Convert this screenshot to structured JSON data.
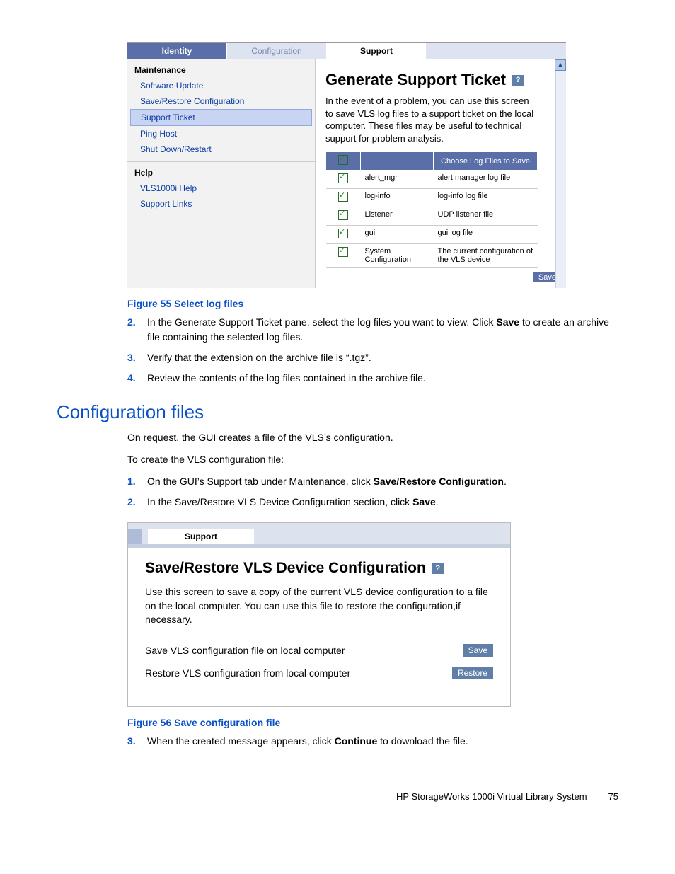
{
  "fig55": {
    "tabs": {
      "identity": "Identity",
      "configuration": "Configuration",
      "support": "Support"
    },
    "sidebar": {
      "maintenance_header": "Maintenance",
      "items_maint": [
        "Software Update",
        "Save/Restore Configuration",
        "Support Ticket",
        "Ping Host",
        "Shut Down/Restart"
      ],
      "help_header": "Help",
      "items_help": [
        "VLS1000i Help",
        "Support Links"
      ]
    },
    "main": {
      "title": "Generate Support Ticket",
      "help_q": "?",
      "desc": "In the event of a problem, you can use this screen to save VLS log files to a support ticket on the local computer. These files may be useful to technical support for problem analysis.",
      "th_choose": "Choose Log Files to Save",
      "rows": [
        {
          "name": "alert_mgr",
          "desc": "alert manager log file"
        },
        {
          "name": "log-info",
          "desc": "log-info log file"
        },
        {
          "name": "Listener",
          "desc": "UDP listener file"
        },
        {
          "name": "gui",
          "desc": "gui log file"
        },
        {
          "name": "System Configuration",
          "desc": "The current configuration of the VLS device"
        }
      ],
      "save": "Save"
    },
    "caption": "Figure 55 Select log files"
  },
  "steps_a": [
    {
      "n": "2.",
      "text_a": "In the Generate Support Ticket pane, select the log files you want to view.  Click ",
      "bold": "Save",
      "text_b": " to create an archive file containing the selected log files."
    },
    {
      "n": "3.",
      "text_a": "Verify that the extension on the archive file is “.tgz”.",
      "bold": "",
      "text_b": ""
    },
    {
      "n": "4.",
      "text_a": "Review the contents of the log files contained in the archive file.",
      "bold": "",
      "text_b": ""
    }
  ],
  "section2": {
    "heading": "Configuration files",
    "p1": "On request, the GUI creates a file of the VLS’s configuration.",
    "p2": "To create the VLS configuration file:",
    "step1_a": "On the GUI’s Support tab under Maintenance, click ",
    "step1_bold": "Save/Restore Configuration",
    "step1_b": ".",
    "step2_a": "In the Save/Restore VLS Device Configuration section, click ",
    "step2_bold": "Save",
    "step2_b": "."
  },
  "fig56": {
    "tab_support": "Support",
    "title": "Save/Restore VLS Device Configuration",
    "help_q": "?",
    "desc": "Use this screen to save a copy of the current VLS device configuration to a file on the local computer. You can use this file to restore the configuration,if necessary.",
    "row1": "Save VLS configuration file on local computer",
    "btn1": "Save",
    "row2": "Restore VLS configuration from local computer",
    "btn2": "Restore",
    "caption": "Figure 56 Save configuration file"
  },
  "step3": {
    "n": "3.",
    "a": "When the created message appears, click ",
    "bold": "Continue",
    "b": " to download the file."
  },
  "footer": {
    "title": "HP StorageWorks 1000i Virtual Library System",
    "page": "75"
  }
}
